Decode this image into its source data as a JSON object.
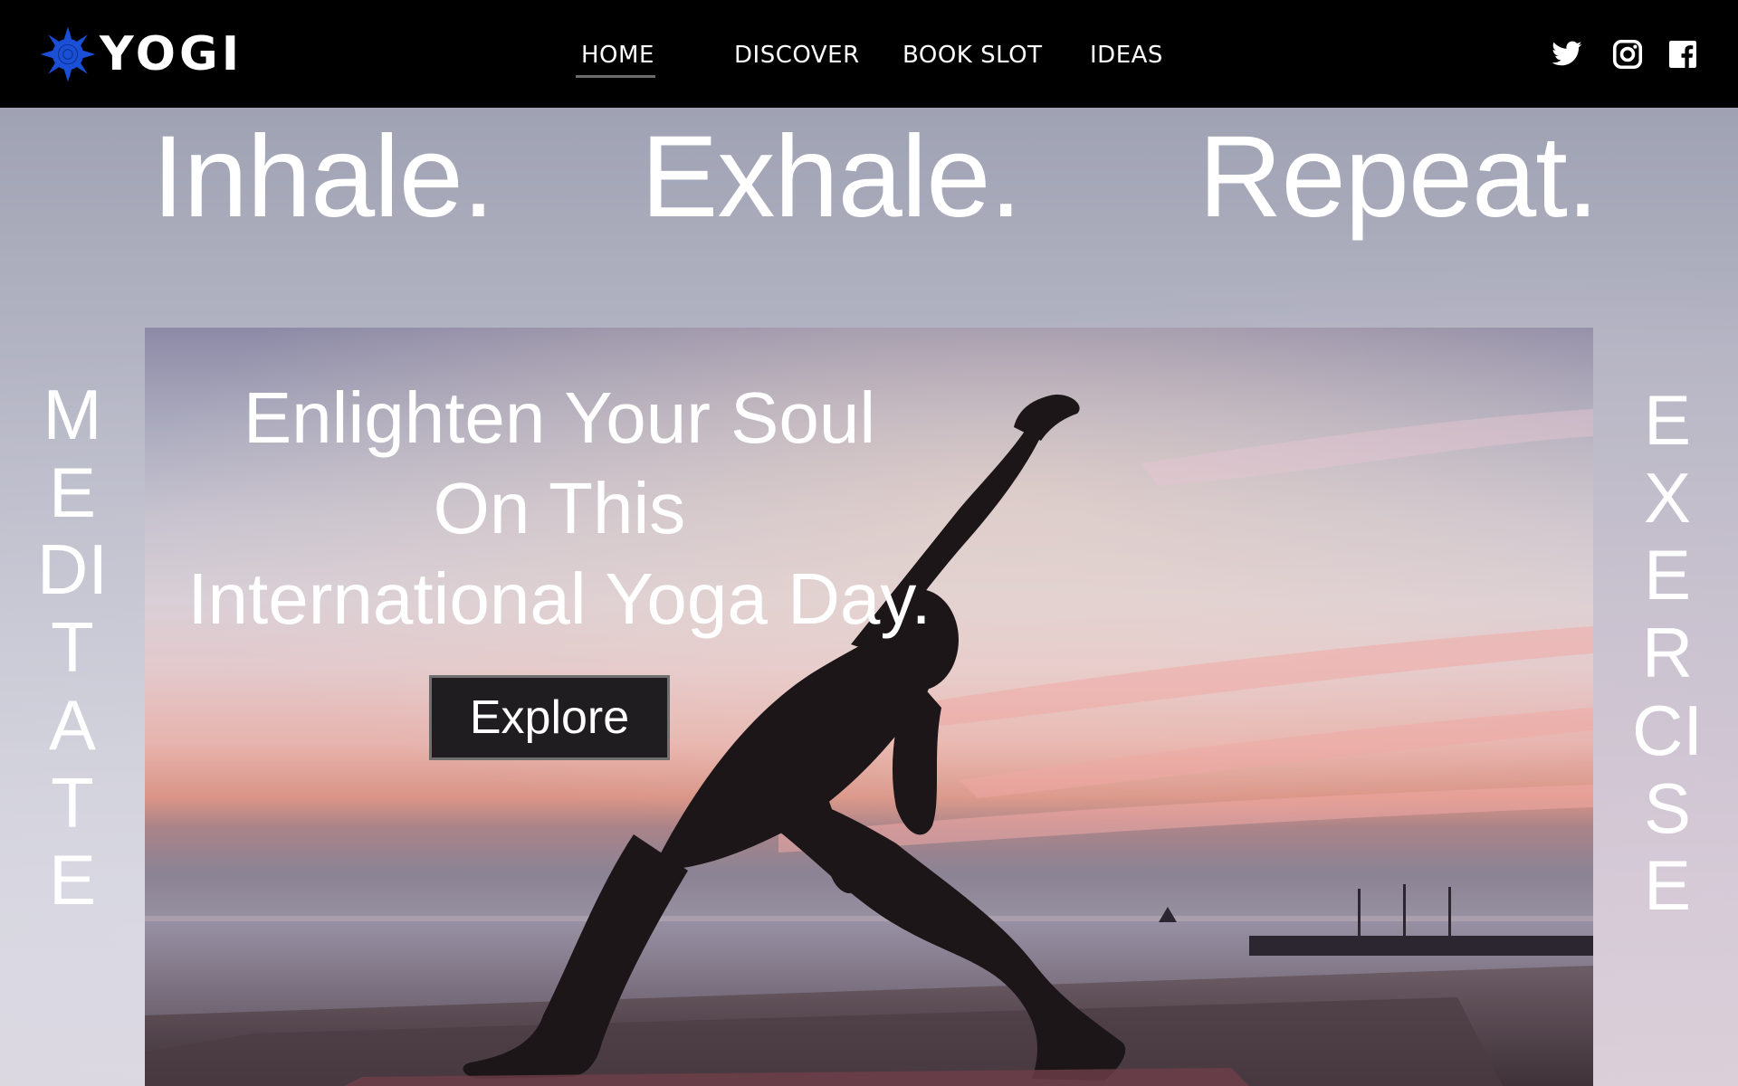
{
  "brand": {
    "name": "YOGI",
    "logo_icon": "lotus-star-icon",
    "logo_color": "#1a4fd6"
  },
  "nav": {
    "items": [
      {
        "label": "HOME",
        "active": true
      },
      {
        "label": "DISCOVER",
        "active": false
      },
      {
        "label": "BOOK SLOT",
        "active": false
      },
      {
        "label": "IDEAS",
        "active": false
      }
    ]
  },
  "social": [
    {
      "icon": "twitter-icon"
    },
    {
      "icon": "instagram-icon"
    },
    {
      "icon": "facebook-icon"
    }
  ],
  "tagline": {
    "words": [
      "Inhale.",
      "Exhale.",
      "Repeat."
    ]
  },
  "side_words": {
    "left": "MEDITATE",
    "right": "EXERCISE"
  },
  "hero": {
    "headline_lines": [
      "Enlighten Your Soul",
      "On This",
      "International Yoga Day."
    ],
    "cta_label": "Explore"
  },
  "colors": {
    "navbar": "#000000",
    "text": "#ffffff",
    "button_bg": "#1f1d1f",
    "button_border": "#6f6f6f"
  }
}
